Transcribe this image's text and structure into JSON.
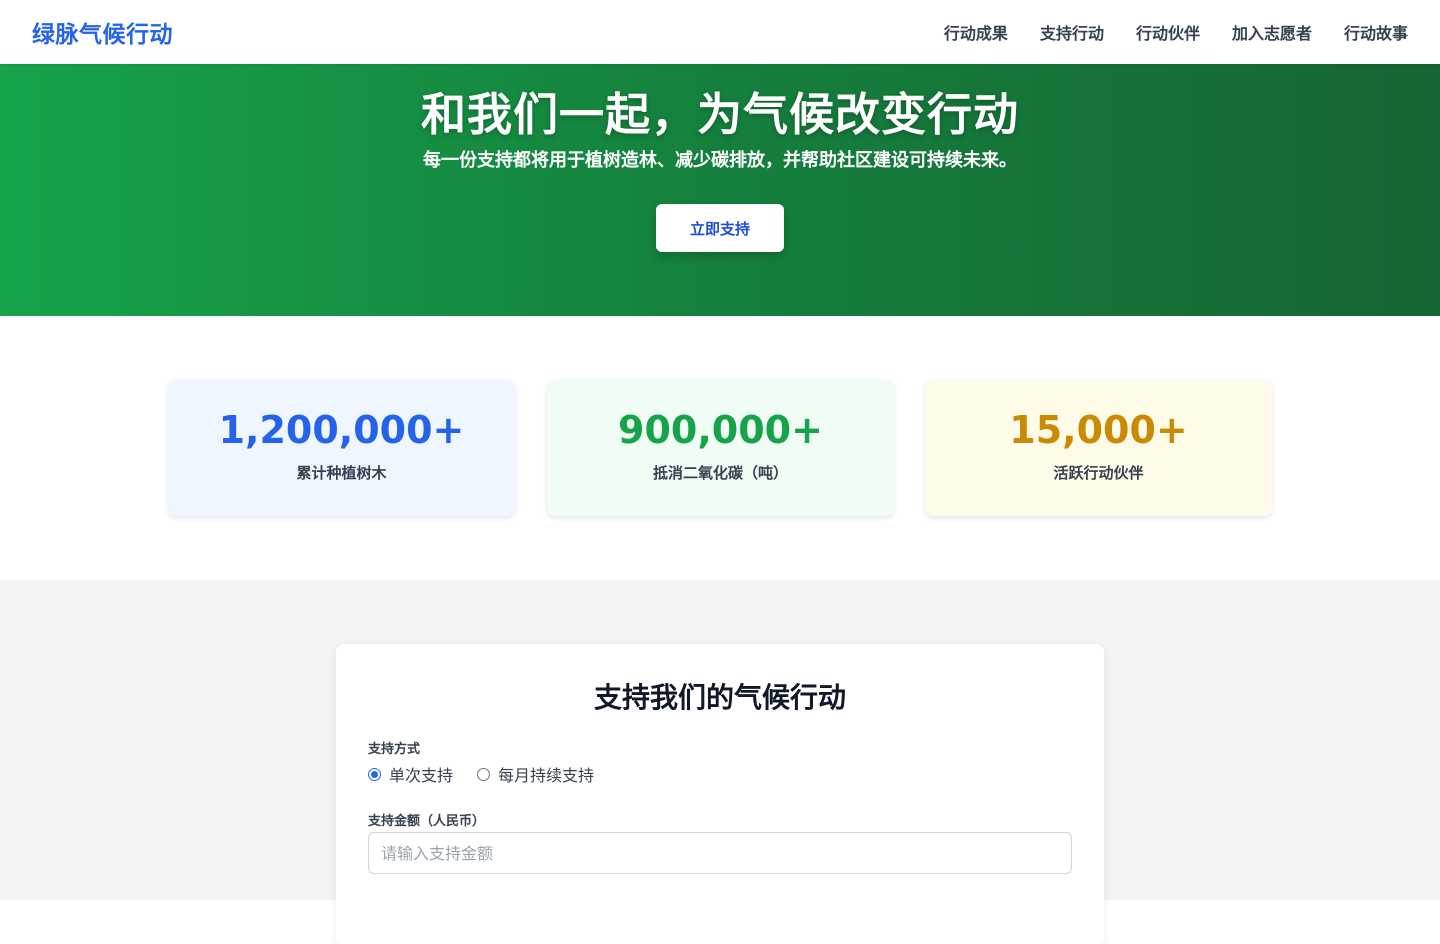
{
  "brand": {
    "name": "绿脉气候行动",
    "color": "#2563eb"
  },
  "nav": {
    "items": [
      {
        "label": "行动成果"
      },
      {
        "label": "支持行动"
      },
      {
        "label": "行动伙伴"
      },
      {
        "label": "加入志愿者"
      },
      {
        "label": "行动故事"
      }
    ]
  },
  "hero": {
    "title": "和我们一起，为气候改变行动",
    "subtitle": "每一份支持都将用于植树造林、减少碳排放，并帮助社区建设可持续未来。",
    "cta_label": "立即支持",
    "gradient_colors": [
      "#16a34a",
      "#166534"
    ]
  },
  "stats": [
    {
      "value": "1,200,000+",
      "label": "累计种植树木",
      "color": "#2563eb"
    },
    {
      "value": "900,000+",
      "label": "抵消二氧化碳（吨）",
      "color": "#16a34a"
    },
    {
      "value": "15,000+",
      "label": "活跃行动伙伴",
      "color": "#ca8a04"
    }
  ],
  "donate": {
    "title": "支持我们的气候行动",
    "method_label": "支持方式",
    "methods": [
      {
        "label": "单次支持",
        "selected": true
      },
      {
        "label": "每月持续支持",
        "selected": false
      }
    ],
    "amount_label": "支持金额（人民币）",
    "amount_value": "",
    "amount_placeholder": "请输入支持金额"
  }
}
